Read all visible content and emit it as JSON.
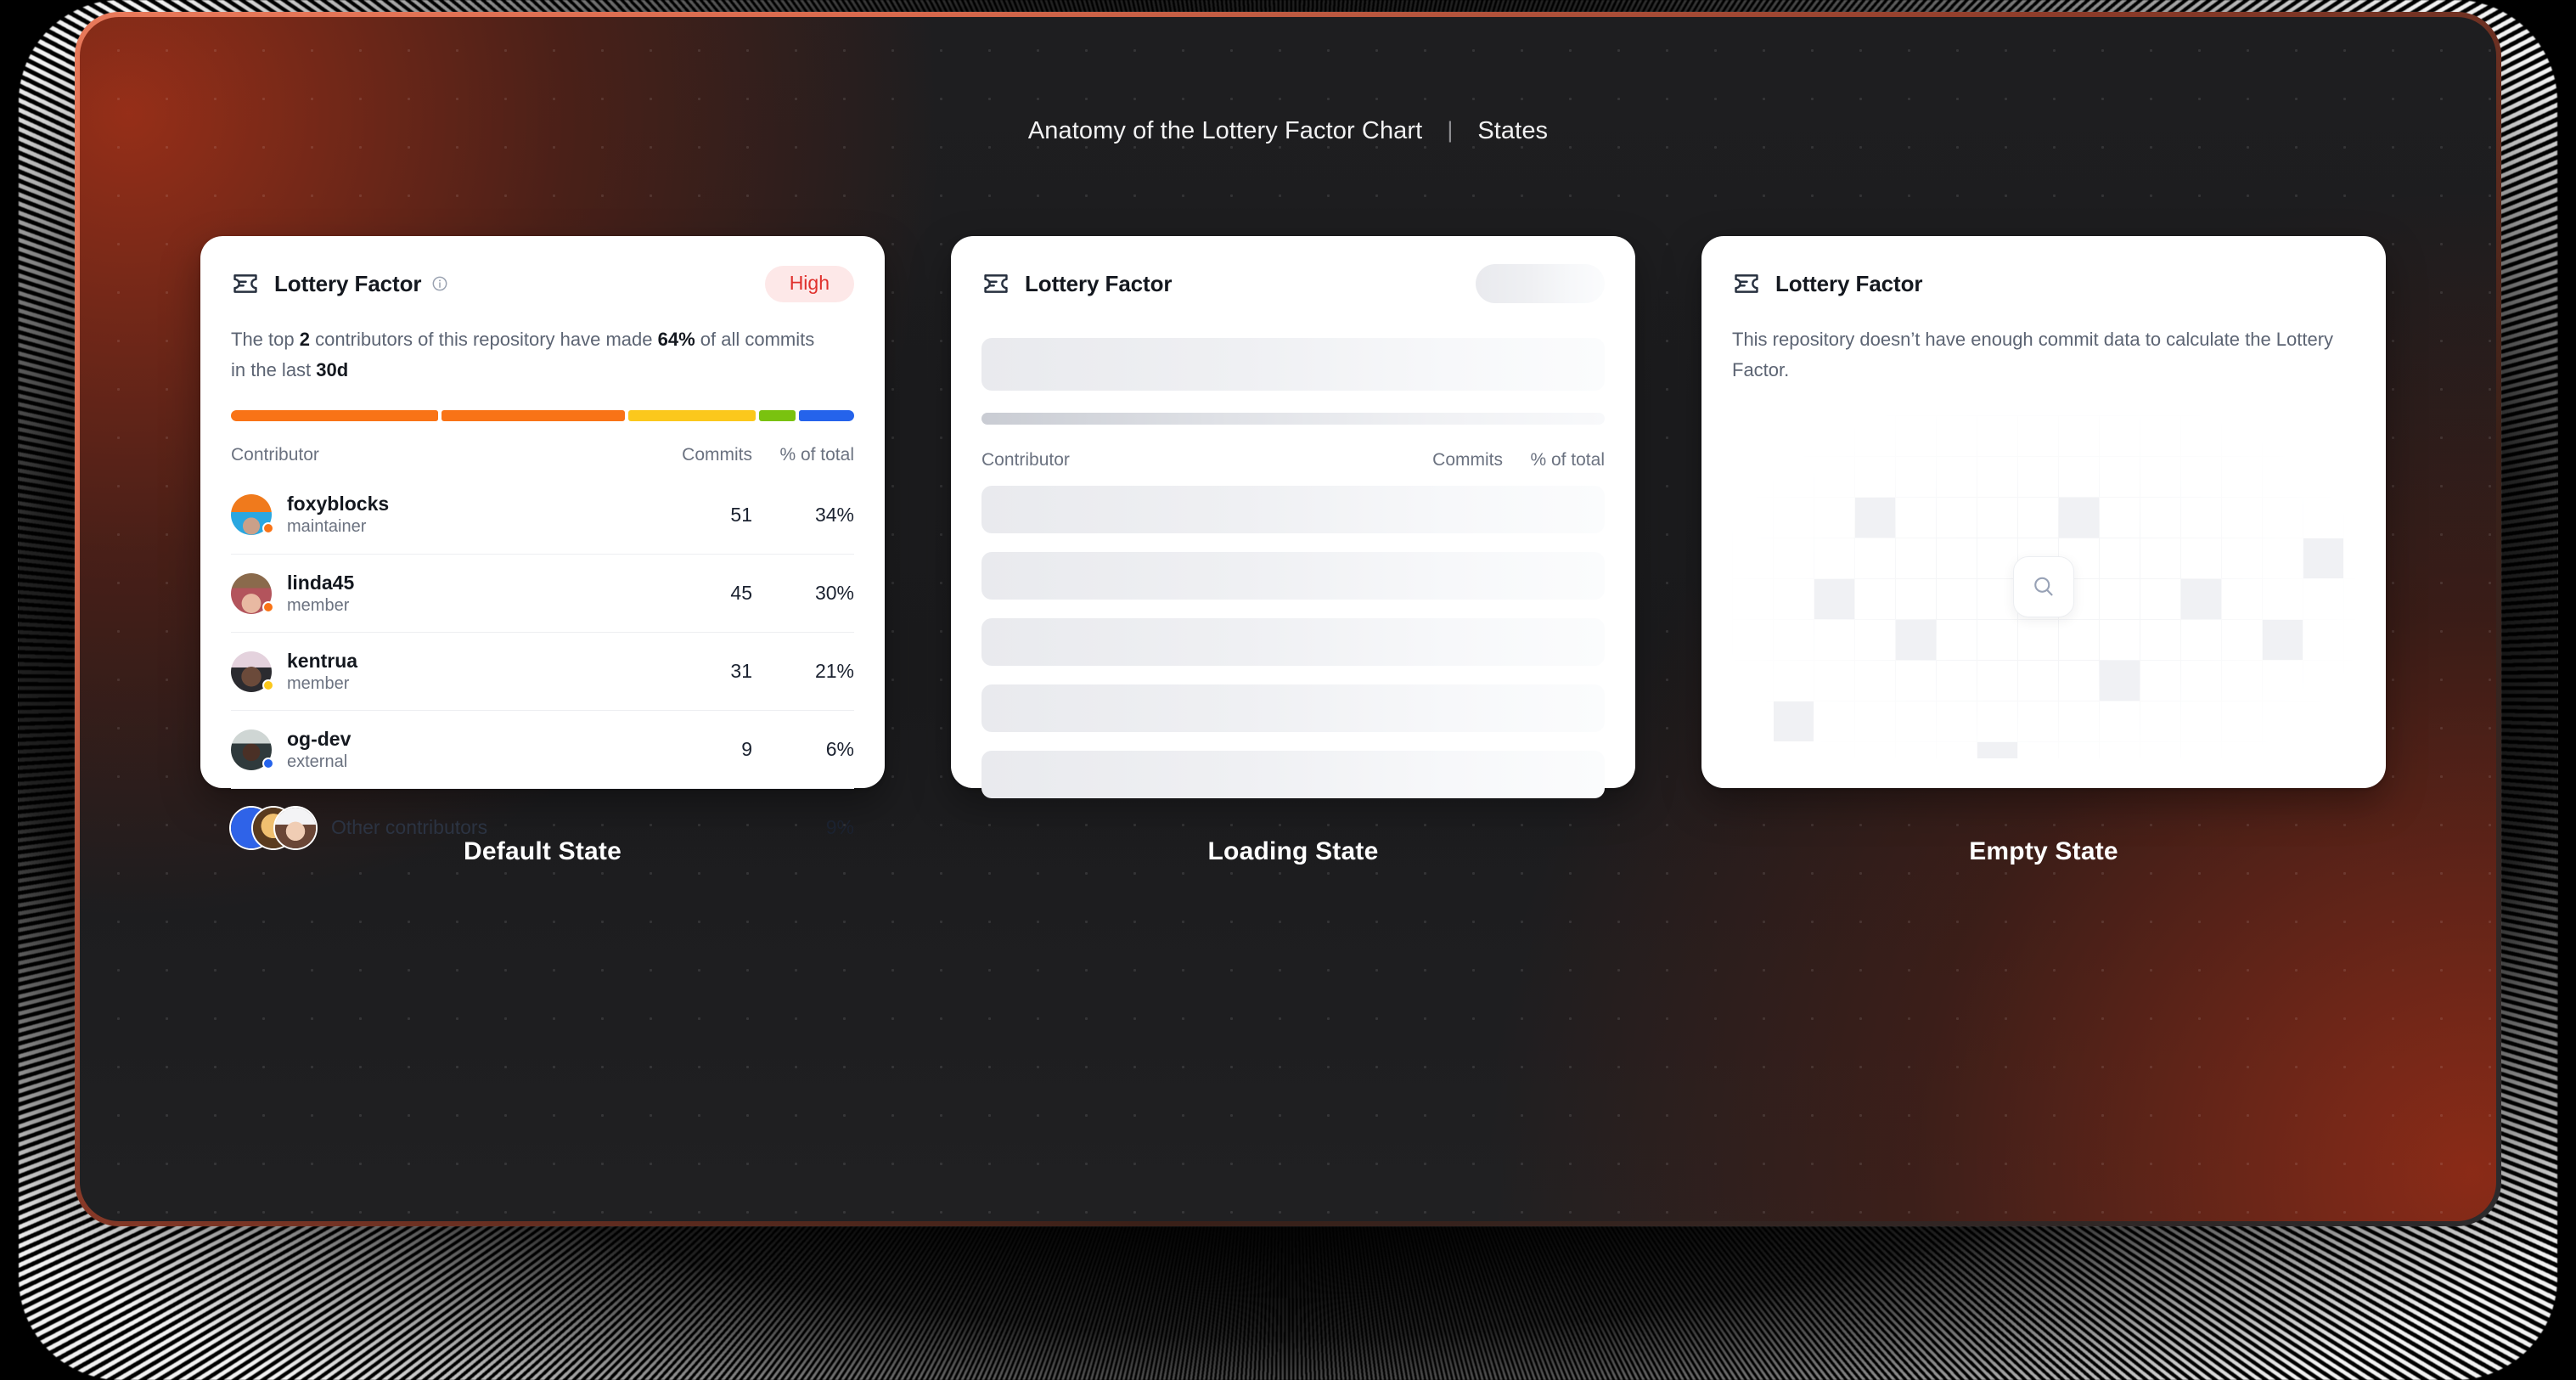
{
  "header": {
    "breadcrumb_primary": "Anatomy of the Lottery Factor Chart",
    "separator": "|",
    "breadcrumb_secondary": "States"
  },
  "colors": {
    "frame_border": "#e8795a",
    "badge_bg": "#fde8e8",
    "badge_text": "#e0302c",
    "segment_1": "#f97316",
    "segment_2": "#f97316",
    "segment_3": "#fbc81c",
    "segment_4": "#7ac20f",
    "segment_5": "#2563eb"
  },
  "cards": {
    "default": {
      "state_label": "Default State",
      "icon_name": "ticket-icon",
      "title": "Lottery Factor",
      "info_icon_name": "info-icon",
      "badge": "High",
      "description": {
        "part1": "The top ",
        "bold1": "2",
        "part2": " contributors of this repository have made ",
        "bold2": "64%",
        "part3": " of all commits in the last ",
        "bold3": "30d"
      },
      "segments": [
        {
          "color": "#f97316",
          "width_pct": 34
        },
        {
          "color": "#f97316",
          "width_pct": 30
        },
        {
          "color": "#fbc81c",
          "width_pct": 21
        },
        {
          "color": "#7ac20f",
          "width_pct": 6
        },
        {
          "color": "#2563eb",
          "width_pct": 9
        }
      ],
      "table": {
        "columns": [
          "Contributor",
          "Commits",
          "% of total"
        ],
        "rows": [
          {
            "name": "foxyblocks",
            "role": "maintainer",
            "commits": "51",
            "pct": "34%",
            "dot": "#f97316"
          },
          {
            "name": "linda45",
            "role": "member",
            "commits": "45",
            "pct": "30%",
            "dot": "#f97316"
          },
          {
            "name": "kentrua",
            "role": "member",
            "commits": "31",
            "pct": "21%",
            "dot": "#fbc81c"
          },
          {
            "name": "og-dev",
            "role": "external",
            "commits": "9",
            "pct": "6%",
            "dot": "#2563eb"
          }
        ],
        "other_row": {
          "label": "Other contributors",
          "commits": "",
          "pct": "9%"
        }
      }
    },
    "loading": {
      "state_label": "Loading State",
      "icon_name": "ticket-icon",
      "title": "Lottery Factor",
      "badge_placeholder": "",
      "skeleton_rows": 5,
      "table": {
        "columns": [
          "Contributor",
          "Commits",
          "% of total"
        ]
      }
    },
    "empty": {
      "state_label": "Empty State",
      "icon_name": "ticket-icon",
      "title": "Lottery Factor",
      "message": "This repository doesn’t have enough commit data to calculate the Lottery Factor.",
      "illustration_icon_name": "search-icon"
    }
  }
}
